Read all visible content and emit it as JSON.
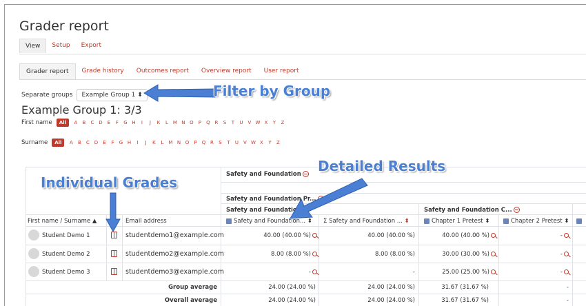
{
  "page": {
    "title": "Grader report"
  },
  "tabs_top": [
    "View",
    "Setup",
    "Export"
  ],
  "tabs_report": [
    "Grader report",
    "Grade history",
    "Outcomes report",
    "Overview report",
    "User report"
  ],
  "group_filter": {
    "label": "Separate groups",
    "selected": "Example Group 1"
  },
  "group_heading": "Example Group 1: 3/3",
  "initials": {
    "firstname_label": "First name",
    "surname_label": "Surname",
    "all_label": "All",
    "letters": [
      "A",
      "B",
      "C",
      "D",
      "E",
      "F",
      "G",
      "H",
      "I",
      "J",
      "K",
      "L",
      "M",
      "N",
      "O",
      "P",
      "Q",
      "R",
      "S",
      "T",
      "U",
      "V",
      "W",
      "X",
      "Y",
      "Z"
    ]
  },
  "annotations": {
    "filter": "Filter by Group",
    "detailed": "Detailed Results",
    "individual": "Individual Grades"
  },
  "table": {
    "category_1": "Safety and Foundation",
    "category_2": "Safety and Foundation Pr...",
    "category_3": "Safety and Foundation",
    "category_4": "Safety and Foundation C...",
    "col_name": "First name / Surname",
    "col_email": "Email address",
    "col_item1": "Safety and Foundation...",
    "col_item2": "Safety and Foundation ...",
    "col_item3": "Chapter 1 Pretest",
    "col_item4": "Chapter 2 Pretest",
    "rows": [
      {
        "name": "Student Demo 1",
        "email": "studentdemo1@example.com",
        "v1": "40.00 (40.00 %)",
        "v2": "40.00 (40.00 %)",
        "v3": "40.00 (40.00 %)",
        "v4": "-"
      },
      {
        "name": "Student Demo 2",
        "email": "studentdemo2@example.com",
        "v1": "8.00 (8.00 %)",
        "v2": "8.00 (8.00 %)",
        "v3": "30.00 (30.00 %)",
        "v4": "-"
      },
      {
        "name": "Student Demo 3",
        "email": "studentdemo3@example.com",
        "v1": "-",
        "v2": "-",
        "v3": "25.00 (25.00 %)",
        "v4": "-"
      }
    ],
    "group_avg": {
      "label": "Group average",
      "v1": "24.00 (24.00 %)",
      "v2": "24.00 (24.00 %)",
      "v3": "31.67 (31.67 %)",
      "v4": "-"
    },
    "overall_avg": {
      "label": "Overall average",
      "v1": "24.00 (24.00 %)",
      "v2": "24.00 (24.00 %)",
      "v3": "31.67 (31.67 %)",
      "v4": "-"
    }
  }
}
